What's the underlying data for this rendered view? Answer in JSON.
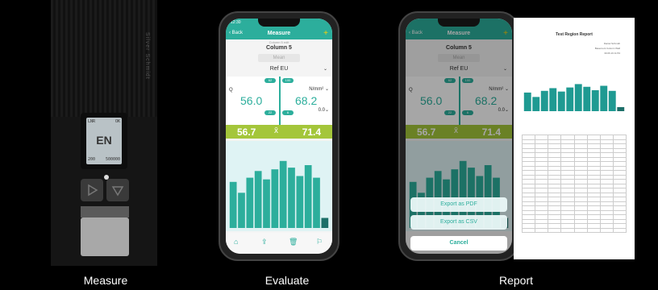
{
  "captions": {
    "measure": "Measure",
    "evaluate": "Evaluate",
    "report": "Report"
  },
  "device": {
    "lcd_top_left": "LNR",
    "lcd_top_right": "OK",
    "lcd_value": "EN",
    "lcd_bottom_left": "200",
    "lcd_bottom_right": "500000",
    "brand": "Silver Schmidt"
  },
  "phone_evaluate": {
    "status_time": "12:30",
    "nav_back": "Back",
    "nav_title": "Measure",
    "subtitle_small": "Column 5 edit",
    "subtitle": "Column 5",
    "mean_label": "Mean",
    "ref_label": "Ref EU",
    "q_label": "Q",
    "pill_left_1": "62",
    "pill_left_2": "100",
    "pill_bottom_1": "22",
    "pill_bottom_2": "6",
    "value_left": "56.0",
    "value_right": "68.2",
    "unit": "N/mm²",
    "dropdown": "0.0",
    "bar_left": "56.7",
    "bar_mid": "x̄",
    "bar_right": "71.4",
    "toolbar": [
      "⌂",
      "⇪",
      "🗑",
      "⚐"
    ]
  },
  "phone_report": {
    "nav_back": "Back",
    "nav_title": "Measure",
    "subtitle": "Column 5",
    "mean_label": "Mean",
    "ref_label": "Ref EU",
    "q_label": "Q",
    "pill_left_1": "62",
    "pill_left_2": "100",
    "pill_bottom_1": "22",
    "pill_bottom_2": "6",
    "value_left": "56.0",
    "value_right": "68.2",
    "unit": "N/mm²",
    "dropdown": "0.0",
    "bar_left": "56.7",
    "bar_mid": "x̄",
    "bar_right": "71.4",
    "sheet_pdf": "Export as PDF",
    "sheet_csv": "Export as CSV",
    "sheet_cancel": "Cancel"
  },
  "report_page": {
    "title": "Test Region Report",
    "meta": [
      "Daniel Schmidt",
      "Basement Column Wall",
      "30.06.19 11:53"
    ]
  },
  "chart_data": {
    "type": "bar",
    "values": [
      55,
      42,
      60,
      68,
      58,
      70,
      80,
      72,
      62,
      75,
      60,
      12
    ]
  },
  "colors": {
    "accent": "#2cae9c",
    "green": "#a4c63a"
  }
}
